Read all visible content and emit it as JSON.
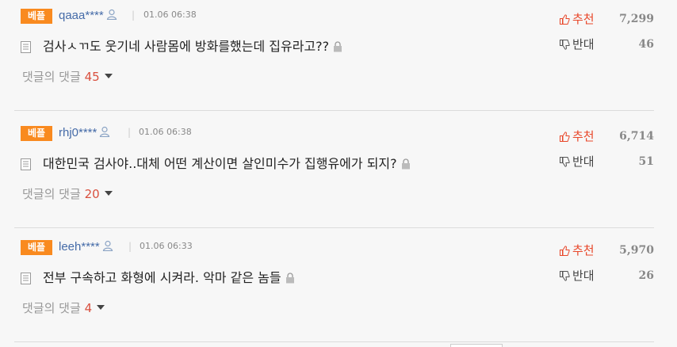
{
  "comments": [
    {
      "badge": "베플",
      "user": "qaaa****",
      "time": "01.06 06:38",
      "text": "검사ㅅㄲ도 웃기네 사람몸에 방화를했는데 집유라고??",
      "replies_label": "댓글의 댓글",
      "replies_count": "45",
      "recommend_label": "추천",
      "recommend_count": "7,299",
      "oppose_label": "반대",
      "oppose_count": "46"
    },
    {
      "badge": "베플",
      "user": "rhj0****",
      "time": "01.06 06:38",
      "text": "대한민국 검사야..대체 어떤 계산이면 살인미수가 집행유에가 되지?",
      "replies_label": "댓글의 댓글",
      "replies_count": "20",
      "recommend_label": "추천",
      "recommend_count": "6,714",
      "oppose_label": "반대",
      "oppose_count": "51"
    },
    {
      "badge": "베플",
      "user": "leeh****",
      "time": "01.06 06:33",
      "text": "전부 구속하고 화형에 시켜라. 악마 같은 놈들",
      "replies_label": "댓글의 댓글",
      "replies_count": "4",
      "recommend_label": "추천",
      "recommend_count": "5,970",
      "oppose_label": "반대",
      "oppose_count": "26"
    }
  ],
  "colors": {
    "badge": "#f98a1f",
    "user": "#456ba8",
    "recommend": "#e8472a",
    "reply_count": "#d9503f"
  },
  "icons": [
    "user-icon",
    "doc-icon",
    "lock-icon",
    "thumbs-up-icon",
    "thumbs-down-icon",
    "caret-down-icon"
  ]
}
